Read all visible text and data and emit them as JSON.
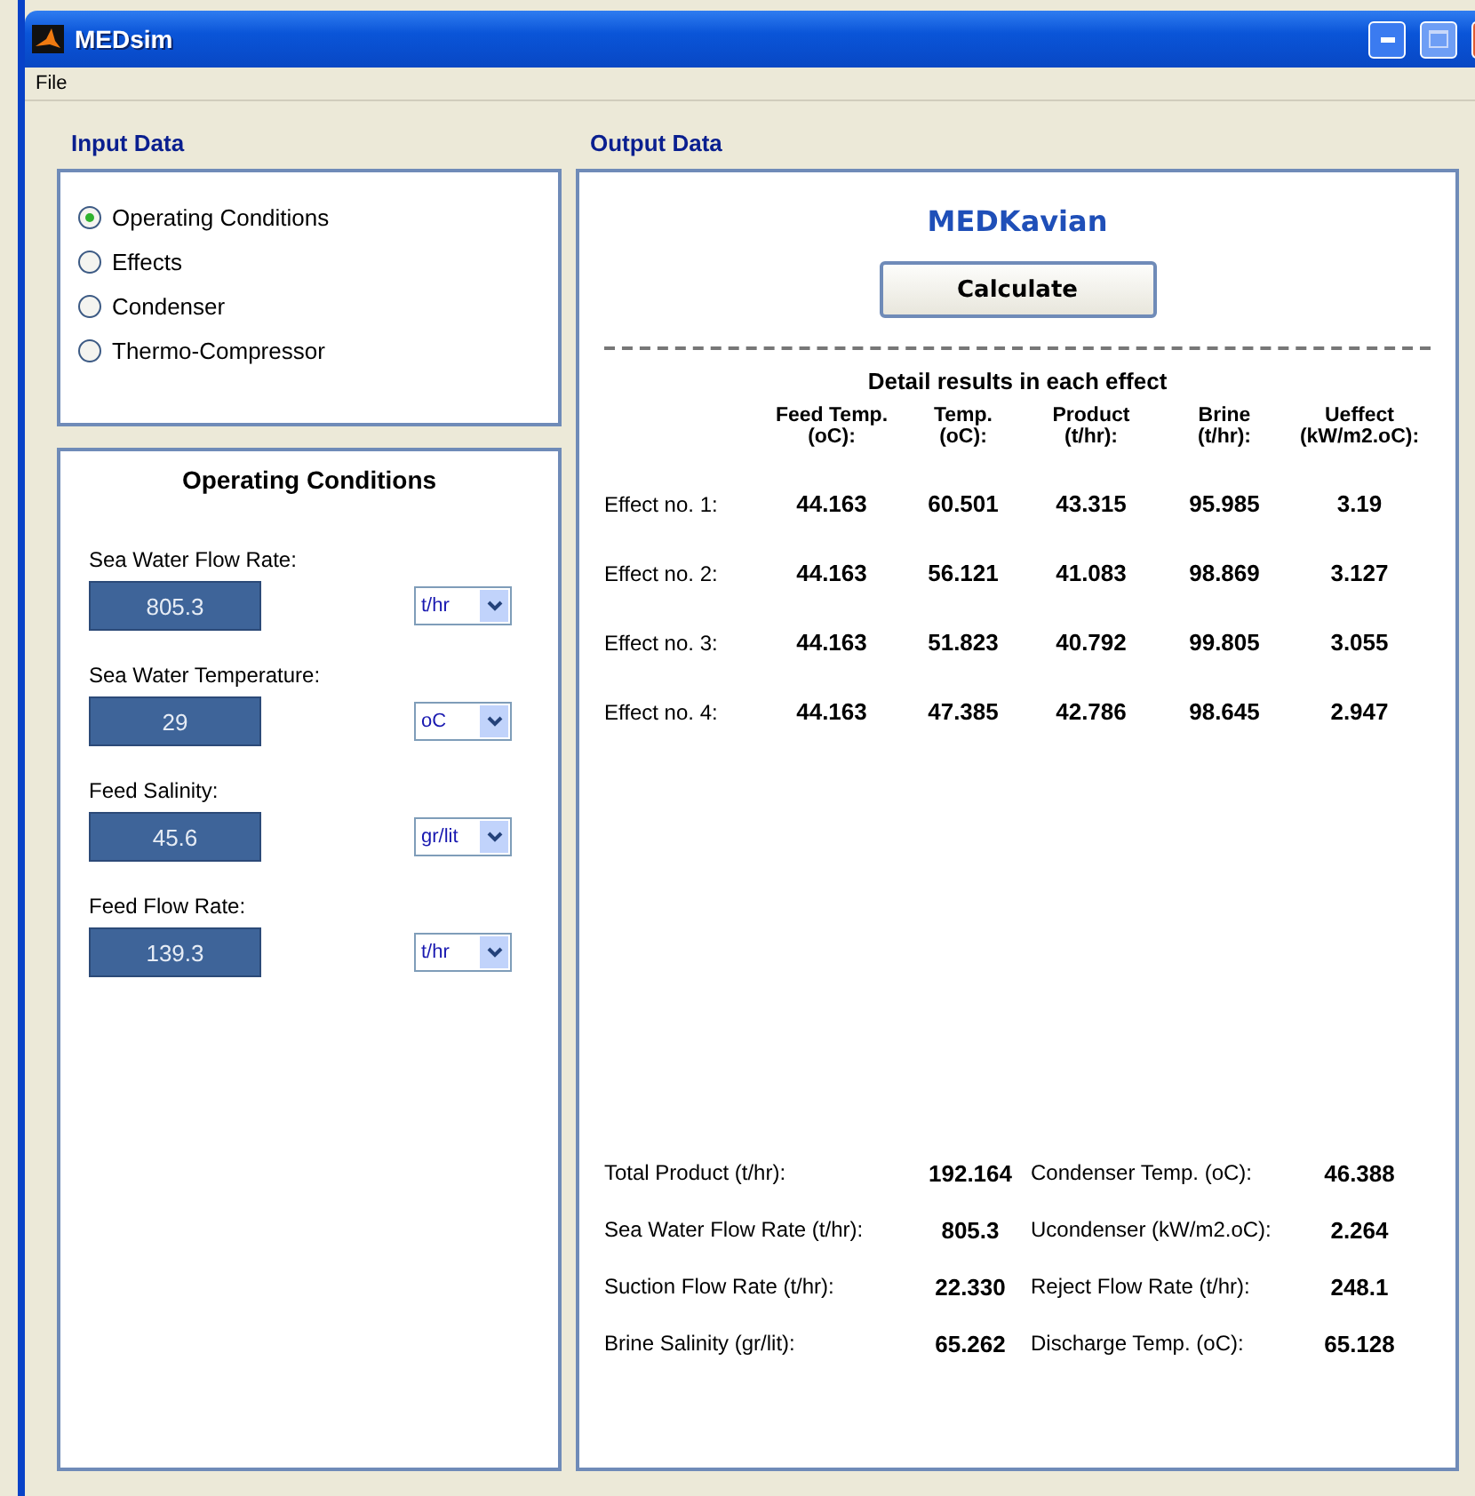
{
  "window": {
    "title": "MEDsim"
  },
  "menu": [
    "File"
  ],
  "input": {
    "title": "Input Data",
    "options": [
      {
        "label": "Operating Conditions",
        "selected": true
      },
      {
        "label": "Effects",
        "selected": false
      },
      {
        "label": "Condenser",
        "selected": false
      },
      {
        "label": "Thermo-Compressor",
        "selected": false
      }
    ]
  },
  "conditions": {
    "title": "Operating Conditions",
    "fields": [
      {
        "label": "Sea Water Flow Rate:",
        "value": "805.3",
        "unit": "t/hr"
      },
      {
        "label": "Sea Water Temperature:",
        "value": "29",
        "unit": "oC"
      },
      {
        "label": "Feed Salinity:",
        "value": "45.6",
        "unit": "gr/lit"
      },
      {
        "label": "Feed Flow Rate:",
        "value": "139.3",
        "unit": "t/hr"
      }
    ]
  },
  "output": {
    "title": "Output Data",
    "brand": "MEDKavian",
    "button": "Calculate",
    "table_title": "Detail results in each effect",
    "columns": [
      "Feed Temp.\n(oC):",
      "Temp.\n(oC):",
      "Product\n(t/hr):",
      "Brine\n(t/hr):",
      "Ueffect\n(kW/m2.oC):"
    ],
    "rows": [
      {
        "label": "Effect no. 1:",
        "cells": [
          "44.163",
          "60.501",
          "43.315",
          "95.985",
          "3.19"
        ]
      },
      {
        "label": "Effect no. 2:",
        "cells": [
          "44.163",
          "56.121",
          "41.083",
          "98.869",
          "3.127"
        ]
      },
      {
        "label": "Effect no. 3:",
        "cells": [
          "44.163",
          "51.823",
          "40.792",
          "99.805",
          "3.055"
        ]
      },
      {
        "label": "Effect no. 4:",
        "cells": [
          "44.163",
          "47.385",
          "42.786",
          "98.645",
          "2.947"
        ]
      }
    ],
    "summary": [
      {
        "label": "Total Product (t/hr):",
        "value": "192.164"
      },
      {
        "label": "Condenser Temp. (oC):",
        "value": "46.388"
      },
      {
        "label": "Sea Water Flow Rate (t/hr):",
        "value": "805.3"
      },
      {
        "label": "Ucondenser (kW/m2.oC):",
        "value": "2.264"
      },
      {
        "label": "Suction Flow Rate (t/hr):",
        "value": "22.330"
      },
      {
        "label": "Reject Flow Rate (t/hr):",
        "value": "248.1"
      },
      {
        "label": "Brine Salinity (gr/lit):",
        "value": "65.262"
      },
      {
        "label": "Discharge Temp. (oC):",
        "value": "65.128"
      }
    ]
  }
}
